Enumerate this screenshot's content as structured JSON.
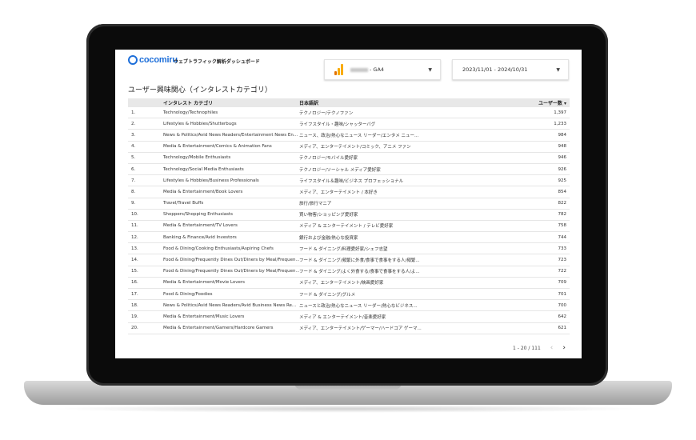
{
  "app": {
    "logo": "cocomiru",
    "title": "ウェブトラフィック解析ダッシュボード"
  },
  "controls": {
    "property_suffix": "- GA4",
    "date_range": "2023/11/01 - 2024/10/31"
  },
  "section_title": "ユーザー興味関心（インタレストカテゴリ）",
  "table": {
    "headers": {
      "category": "インタレスト カテゴリ",
      "japanese": "日本語訳",
      "users": "ユーザー数 ▾"
    },
    "rows": [
      {
        "idx": "1.",
        "category": "Technology/Technophiles",
        "japanese": "テクノロジー/テクノファン",
        "users": "1,397"
      },
      {
        "idx": "2.",
        "category": "Lifestyles & Hobbies/Shutterbugs",
        "japanese": "ライフスタイル・趣味/シャッターバグ",
        "users": "1,233"
      },
      {
        "idx": "3.",
        "category": "News & Politics/Avid News Readers/Entertainment News En...",
        "japanese": "ニュース、政治/熱心なニュース リーダー/エンタメ ニュー...",
        "users": "984"
      },
      {
        "idx": "4.",
        "category": "Media & Entertainment/Comics & Animation Fans",
        "japanese": "メディア、エンターテイメント/コミック、アニメ ファン",
        "users": "948"
      },
      {
        "idx": "5.",
        "category": "Technology/Mobile Enthusiasts",
        "japanese": "テクノロジー/モバイル愛好家",
        "users": "946"
      },
      {
        "idx": "6.",
        "category": "Technology/Social Media Enthusiasts",
        "japanese": "テクノロジー/ソーシャル メディア愛好家",
        "users": "926"
      },
      {
        "idx": "7.",
        "category": "Lifestyles & Hobbies/Business Professionals",
        "japanese": "ライフスタイル＆趣味/ビジネス プロフェッショナル",
        "users": "925"
      },
      {
        "idx": "8.",
        "category": "Media & Entertainment/Book Lovers",
        "japanese": "メディア、エンターテイメント / 本好き",
        "users": "854"
      },
      {
        "idx": "9.",
        "category": "Travel/Travel Buffs",
        "japanese": "旅行/旅行マニア",
        "users": "822"
      },
      {
        "idx": "10.",
        "category": "Shoppers/Shopping Enthusiasts",
        "japanese": "買い物客/ショッピング愛好家",
        "users": "782"
      },
      {
        "idx": "11.",
        "category": "Media & Entertainment/TV Lovers",
        "japanese": "メディア & エンターテイメント / テレビ愛好家",
        "users": "758"
      },
      {
        "idx": "12.",
        "category": "Banking & Finance/Avid Investors",
        "japanese": "銀行および金融/熱心な投資家",
        "users": "744"
      },
      {
        "idx": "13.",
        "category": "Food & Dining/Cooking Enthusiasts/Aspiring Chefs",
        "japanese": "フード & ダイニング/料理愛好家/シェフ志望",
        "users": "733"
      },
      {
        "idx": "14.",
        "category": "Food & Dining/Frequently Dines Out/Diners by Meal/Frequen...",
        "japanese": "フード & ダイニング/頻繁に外食/食事で食事をする人/頻繁...",
        "users": "723"
      },
      {
        "idx": "15.",
        "category": "Food & Dining/Frequently Dines Out/Diners by Meal/Frequen...",
        "japanese": "フード & ダイニング/よく外食する/食事で食事をする人/よ...",
        "users": "722"
      },
      {
        "idx": "16.",
        "category": "Media & Entertainment/Movie Lovers",
        "japanese": "メディア、エンターテイメント/映画愛好家",
        "users": "709"
      },
      {
        "idx": "17.",
        "category": "Food & Dining/Foodies",
        "japanese": "フード & ダイニング/グルメ",
        "users": "701"
      },
      {
        "idx": "18.",
        "category": "News & Politics/Avid News Readers/Avid Business News Re...",
        "japanese": "ニュースと政治/熱心なニュース リーダー/熱心なビジネス...",
        "users": "700"
      },
      {
        "idx": "19.",
        "category": "Media & Entertainment/Music Lovers",
        "japanese": "メディア & エンターテイメント/音楽愛好家",
        "users": "642"
      },
      {
        "idx": "20.",
        "category": "Media & Entertainment/Gamers/Hardcore Gamers",
        "japanese": "メディア、エンターテイメント/ゲーマー/ハードコア ゲーマ...",
        "users": "621"
      }
    ]
  },
  "pagination": {
    "range": "1 - 20 / 111",
    "prev": "‹",
    "next": "›"
  }
}
